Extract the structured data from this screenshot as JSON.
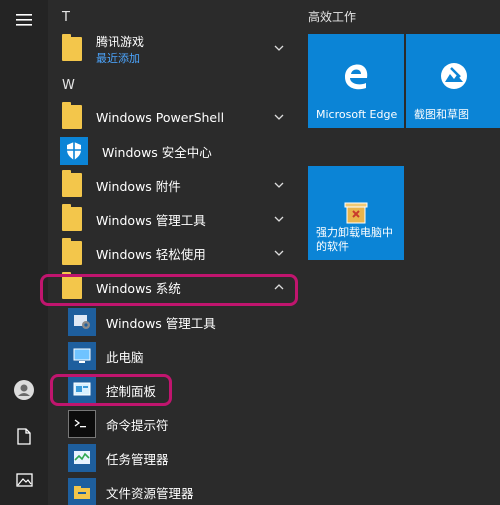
{
  "rail": {
    "items": [
      {
        "icon": "hamburger-menu-icon"
      },
      {
        "icon": "user-avatar-icon"
      },
      {
        "icon": "document-icon"
      },
      {
        "icon": "pictures-icon"
      }
    ]
  },
  "applist": {
    "groups": [
      {
        "letter": "T"
      },
      {
        "letter": "W"
      }
    ],
    "tencent": {
      "name": "腾讯游戏",
      "status": "最近添加"
    },
    "items": [
      {
        "label": "Windows PowerShell"
      },
      {
        "label": "Windows 安全中心"
      },
      {
        "label": "Windows 附件"
      },
      {
        "label": "Windows 管理工具"
      },
      {
        "label": "Windows 轻松使用"
      },
      {
        "label": "Windows 系统"
      }
    ],
    "system_items": [
      {
        "label": "Windows 管理工具"
      },
      {
        "label": "此电脑"
      },
      {
        "label": "控制面板"
      },
      {
        "label": "命令提示符"
      },
      {
        "label": "任务管理器"
      },
      {
        "label": "文件资源管理器"
      }
    ]
  },
  "tiles": {
    "group_title": "高效工作",
    "items": [
      {
        "label": "Microsoft Edge"
      },
      {
        "label": "截图和草图"
      },
      {
        "label": "强力卸载电脑中的软件"
      }
    ]
  },
  "colors": {
    "background": "#2b2b2b",
    "tile": "#0b84d6",
    "folder": "#f3c64b",
    "highlight": "#c0156e",
    "recent": "#4ca6ff"
  }
}
